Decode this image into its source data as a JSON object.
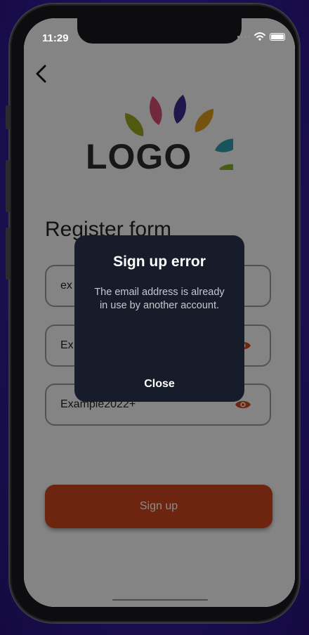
{
  "status_bar": {
    "time": "11:29"
  },
  "nav": {
    "back_icon": "chevron-left-icon"
  },
  "logo": {
    "text": "LOGO",
    "leaf_colors": [
      "#96a51f",
      "#d24b72",
      "#3e2a8c",
      "#d89a1a",
      "#2f9aa8",
      "#7fae2e"
    ]
  },
  "form": {
    "title": "Register form",
    "email": {
      "value": "ex"
    },
    "password": {
      "value": "Ex"
    },
    "confirm_password": {
      "value": "Example2022+"
    },
    "signup_label": "Sign up"
  },
  "dialog": {
    "title": "Sign up error",
    "message": "The email address is already in use by another account.",
    "close_label": "Close"
  },
  "colors": {
    "accent": "#c9451f",
    "eye_icon": "#c9451f",
    "dialog_bg": "#171c2a"
  }
}
